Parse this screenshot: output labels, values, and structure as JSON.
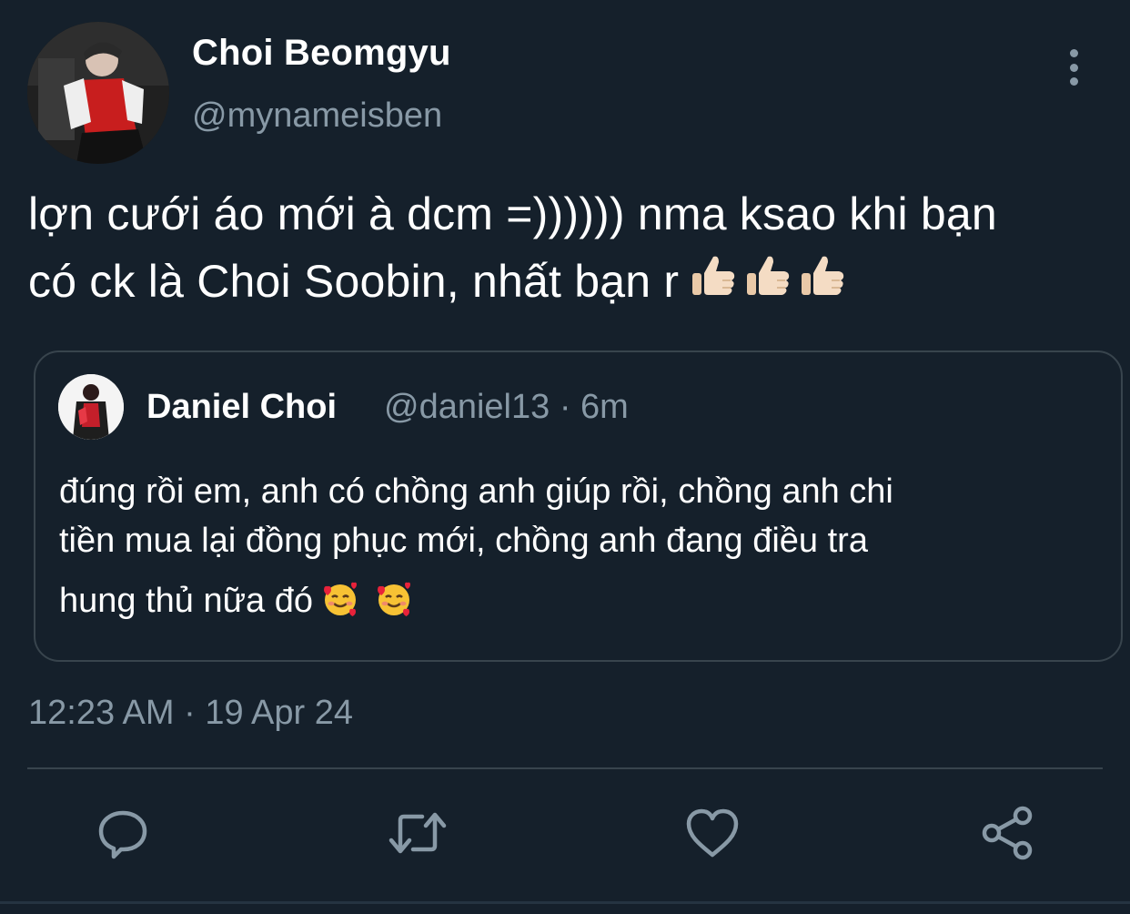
{
  "tweet": {
    "author": {
      "display_name": "Choi Beomgyu",
      "handle": "@mynameisben"
    },
    "text_line1": "lợn cưới áo mới à dcm =)))))) nma ksao khi bạn",
    "text_line2": "có ck là Choi Soobin, nhất bạn r",
    "text_emojis": [
      "thumbs-up-light-skin",
      "thumbs-up-light-skin",
      "thumbs-up-light-skin"
    ],
    "timestamp": "12:23 AM · 19 Apr 24"
  },
  "quoted_tweet": {
    "display_name": "Daniel Choi",
    "meta": "@daniel13 · 6m",
    "text_line1": "đúng rồi em, anh có chồng anh giúp rồi, chồng anh chi",
    "text_line2": "tiền mua lại đồng phục mới, chồng anh đang điều tra",
    "text_line3": "hung thủ nữa đó",
    "text_emojis": [
      "smiling-face-with-hearts",
      "smiling-face-with-hearts"
    ]
  },
  "actions": [
    {
      "name": "reply",
      "icon": "comment-icon"
    },
    {
      "name": "retweet",
      "icon": "retweet-icon"
    },
    {
      "name": "like",
      "icon": "heart-icon"
    },
    {
      "name": "share",
      "icon": "share-icon"
    }
  ],
  "colors": {
    "background": "#15202b",
    "primary_text": "#ffffff",
    "secondary_text": "#8899a6",
    "border": "#38444d"
  }
}
